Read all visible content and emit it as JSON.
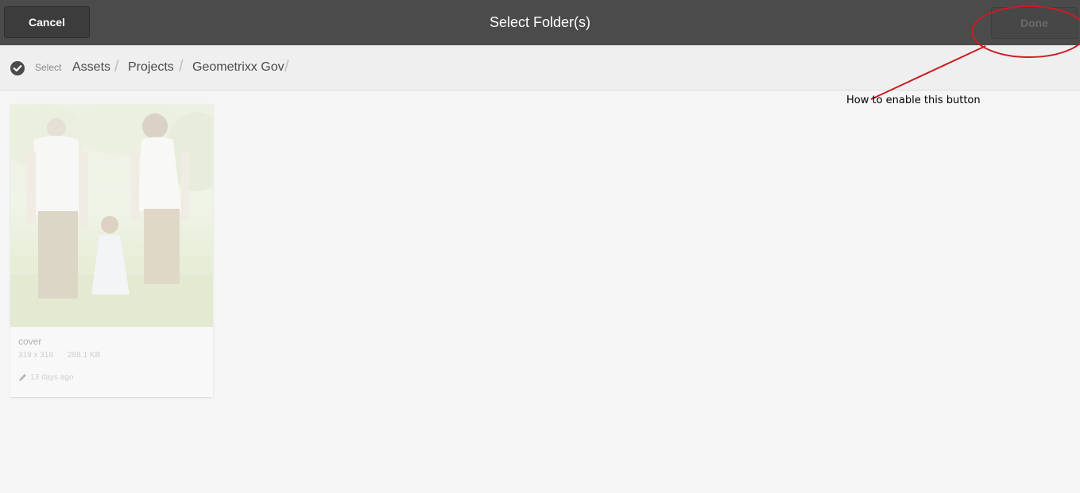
{
  "header": {
    "cancel_label": "Cancel",
    "title": "Select Folder(s)",
    "done_label": "Done"
  },
  "breadcrumb": {
    "select_label": "Select",
    "items": [
      "Assets",
      "Projects",
      "Geometrixx Gov"
    ]
  },
  "card": {
    "title": "cover",
    "dimensions": "319 x 319",
    "size": "288.1 KB",
    "modified": "13 days ago"
  },
  "annotation": {
    "text": "How to enable this button",
    "color": "#cc1b22"
  },
  "colors": {
    "topbar": "#4b4b4b",
    "crumbbar": "#efefef",
    "page": "#f5f5f5"
  },
  "icons": {
    "select": "check-circle-icon",
    "edit": "pencil-icon"
  }
}
